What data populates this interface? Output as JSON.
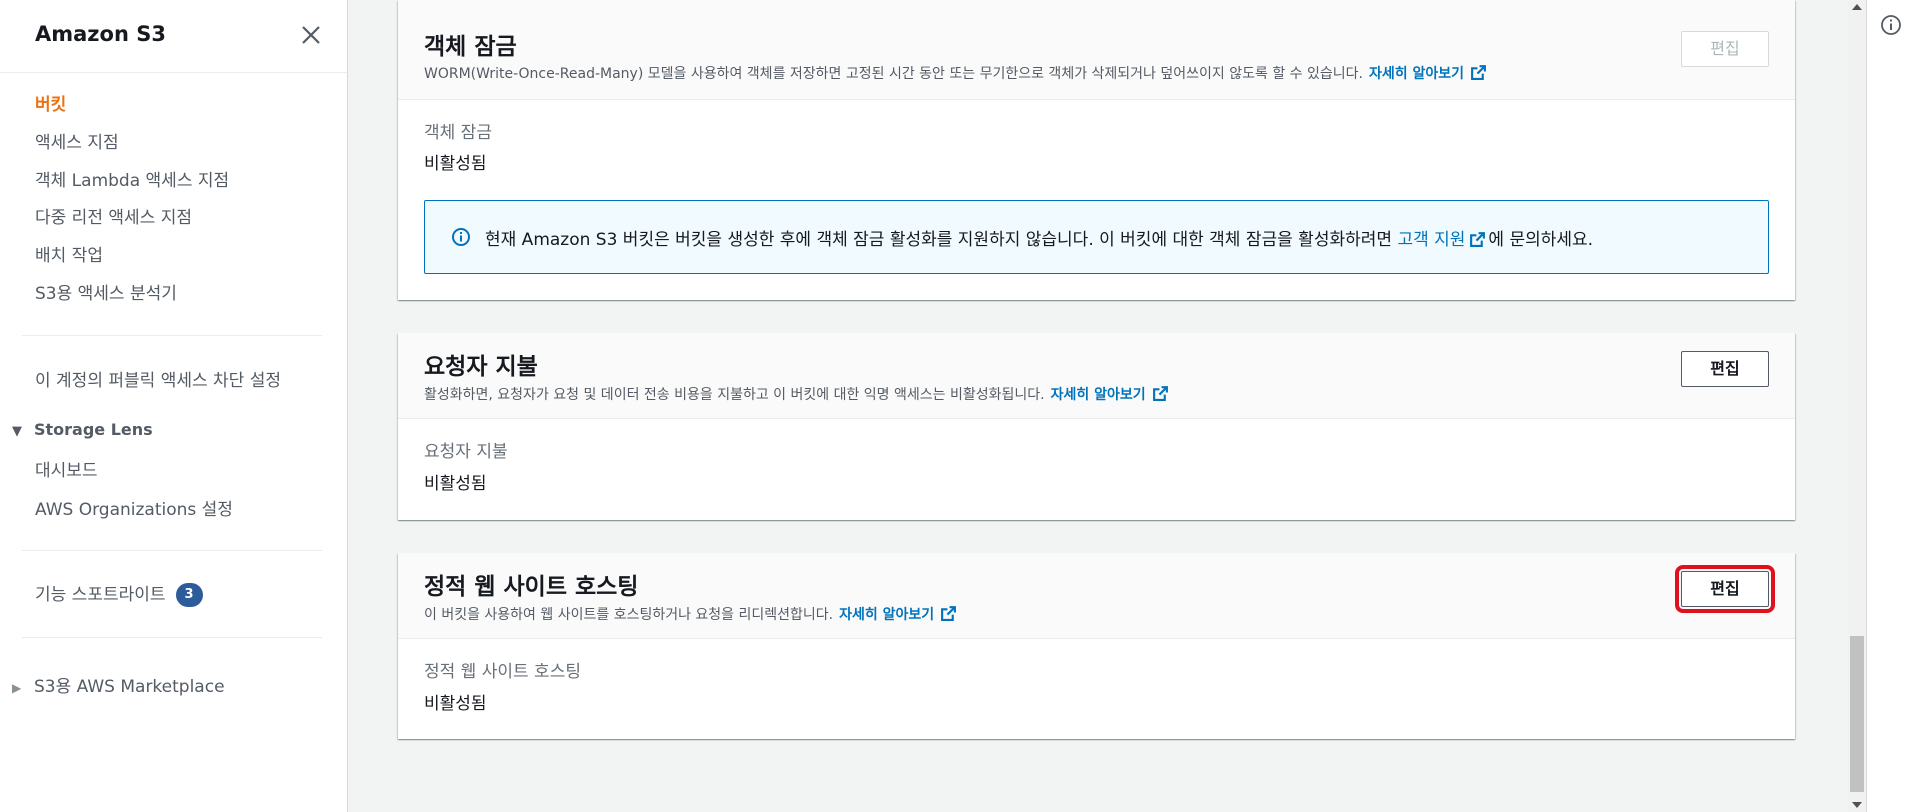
{
  "sidebar": {
    "title": "Amazon S3",
    "items": [
      {
        "label": "버킷",
        "active": true
      },
      {
        "label": "액세스 지점"
      },
      {
        "label": "객체 Lambda 액세스 지점"
      },
      {
        "label": "다중 리전 액세스 지점"
      },
      {
        "label": "배치 작업"
      },
      {
        "label": "S3용 액세스 분석기"
      }
    ],
    "block_public_access": "이 계정의 퍼블릭 액세스 차단 설정",
    "storage_lens": {
      "label": "Storage Lens",
      "items": [
        {
          "label": "대시보드"
        },
        {
          "label": "AWS Organizations 설정"
        }
      ]
    },
    "feature_spotlight": {
      "label": "기능 스포트라이트",
      "badge": "3"
    },
    "marketplace": "S3용 AWS Marketplace"
  },
  "object_lock": {
    "title": "객체 잠금",
    "description": "WORM(Write-Once-Read-Many) 모델을 사용하여 객체를 저장하면 고정된 시간 동안 또는 무기한으로 객체가 삭제되거나 덮어쓰이지 않도록 할 수 있습니다.",
    "learn_more": "자세히 알아보기",
    "edit_label": "편집",
    "field_label": "객체 잠금",
    "field_value": "비활성됨",
    "info_prefix": "현재 Amazon S3 버킷은 버킷을 생성한 후에 객체 잠금 활성화를 지원하지 않습니다. 이 버킷에 대한 객체 잠금을 활성화하려면",
    "info_link": "고객 지원",
    "info_suffix": "에 문의하세요."
  },
  "requester_pays": {
    "title": "요청자 지불",
    "description": "활성화하면, 요청자가 요청 및 데이터 전송 비용을 지불하고 이 버킷에 대한 익명 액세스는 비활성화됩니다.",
    "learn_more": "자세히 알아보기",
    "edit_label": "편집",
    "field_label": "요청자 지불",
    "field_value": "비활성됨"
  },
  "static_website": {
    "title": "정적 웹 사이트 호스팅",
    "description": "이 버킷을 사용하여 웹 사이트를 호스팅하거나 요청을 리디렉션합니다.",
    "learn_more": "자세히 알아보기",
    "edit_label": "편집",
    "field_label": "정적 웹 사이트 호스팅",
    "field_value": "비활성됨"
  },
  "colors": {
    "accent": "#ec7211",
    "link": "#0073bb",
    "highlight": "#e0111c",
    "badge": "#2e5c9a"
  }
}
